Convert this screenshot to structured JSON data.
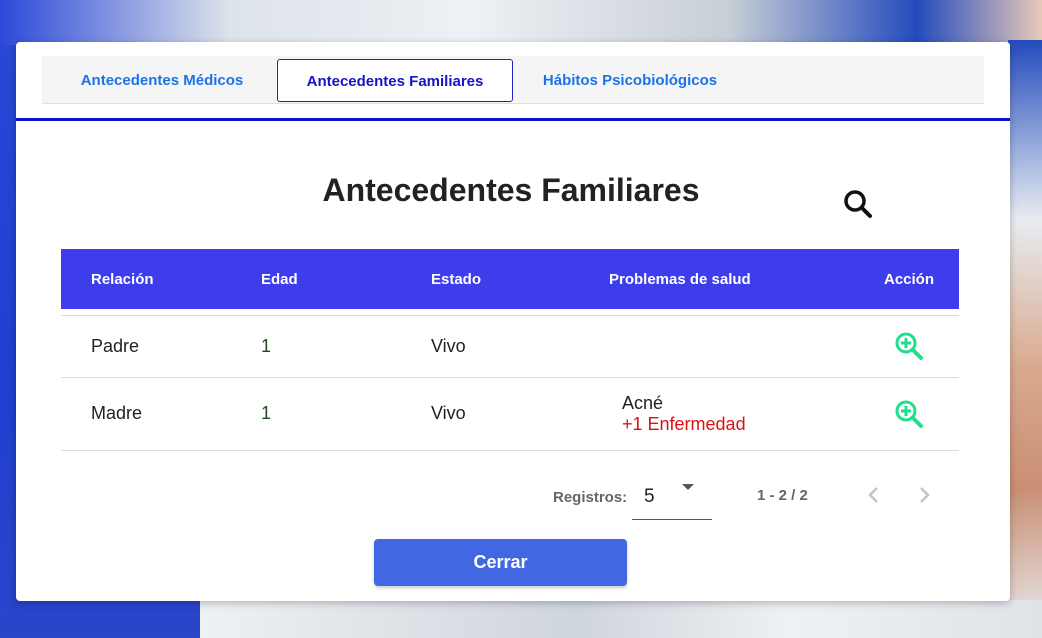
{
  "tabs": [
    {
      "label": "Antecedentes Médicos"
    },
    {
      "label": "Antecedentes Familiares",
      "active": true
    },
    {
      "label": "Hábitos Psicobiológicos"
    }
  ],
  "title": "Antecedentes Familiares",
  "table": {
    "headers": [
      "Relación",
      "Edad",
      "Estado",
      "Problemas de salud",
      "Acción"
    ],
    "rows": [
      {
        "relacion": "Padre",
        "edad": "1",
        "estado": "Vivo",
        "problemas": "",
        "extra": ""
      },
      {
        "relacion": "Madre",
        "edad": "1",
        "estado": "Vivo",
        "problemas": "Acné",
        "extra": "+1 Enfermedad"
      }
    ]
  },
  "pagination": {
    "label": "Registros:",
    "page_size": "5",
    "range": "1 - 2 / 2"
  },
  "close_label": "Cerrar",
  "colors": {
    "header_bg": "#3d3deb",
    "tab_active_border": "#1e22c8",
    "action_icon": "#1ee08c",
    "extra_text": "#e01010",
    "close_button": "#4267e2"
  },
  "icons": {
    "search": "search-icon",
    "view": "zoom-in-icon",
    "prev": "chevron-left-icon",
    "next": "chevron-right-icon"
  }
}
